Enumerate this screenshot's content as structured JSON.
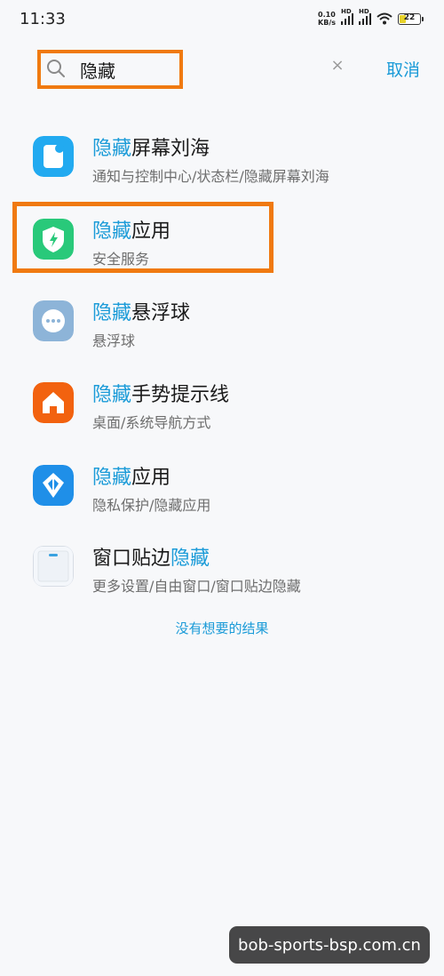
{
  "status_bar": {
    "time": "11:33",
    "net_speed_value": "0.10",
    "net_speed_unit": "KB/s",
    "signal_label": "HD",
    "battery": "22"
  },
  "search": {
    "query": "隐藏",
    "cancel_label": "取消"
  },
  "results": [
    {
      "title_hl": "隐藏",
      "title_rest": "屏幕刘海",
      "subtitle": "通知与控制中心/状态栏/隐藏屏幕刘海",
      "icon": "notch-icon"
    },
    {
      "title_hl": "隐藏",
      "title_rest": "应用",
      "subtitle": "安全服务",
      "icon": "security-shield-icon"
    },
    {
      "title_hl": "隐藏",
      "title_rest": "悬浮球",
      "subtitle": "悬浮球",
      "icon": "floating-ball-icon"
    },
    {
      "title_hl": "隐藏",
      "title_rest": "手势提示线",
      "subtitle": "桌面/系统导航方式",
      "icon": "home-icon"
    },
    {
      "title_hl": "隐藏",
      "title_rest": "应用",
      "subtitle": "隐私保护/隐藏应用",
      "icon": "privacy-icon"
    },
    {
      "title_pre": "窗口贴边",
      "title_hl": "隐藏",
      "subtitle": "更多设置/自由窗口/窗口贴边隐藏",
      "icon": "window-edge-icon"
    }
  ],
  "no_result_link": "没有想要的结果",
  "watermark": "bob-sports-bsp.com.cn",
  "colors": {
    "accent": "#1b9bd8",
    "annotation_orange": "#f07a10"
  }
}
